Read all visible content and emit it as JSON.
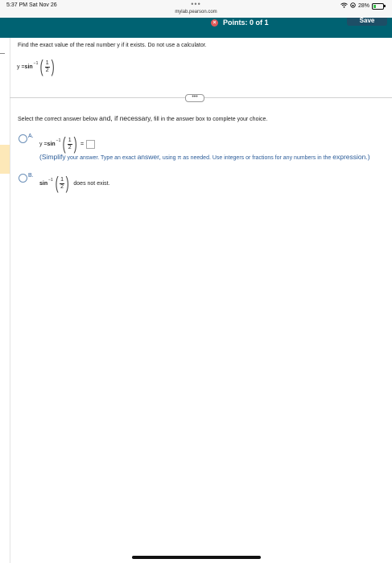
{
  "status_bar": {
    "time": "5:37 PM  Sat Nov 26",
    "dots": "•••",
    "url": "mylab.pearson.com",
    "battery": "28%",
    "battery_level": 0.28
  },
  "header": {
    "points_label": "Points: 0 of 1",
    "save_label": "Save"
  },
  "question": {
    "text": "Find the exact value of the real number y if it exists. Do not use a calculator.",
    "expr_lhs": "y = ",
    "func": "sin",
    "exponent": "−1",
    "frac_num": "1",
    "frac_den": "2"
  },
  "expand_handle": "•••",
  "instruction": {
    "part1": "Select the correct answer below ",
    "part2": "and, if necessary,",
    "part3": " fill in the answer box to complete your choice."
  },
  "options": [
    {
      "letter": "A.",
      "expr_lhs": "y = ",
      "func": "sin",
      "exponent": "−1",
      "frac_num": "1",
      "frac_den": "2",
      "equals": "=",
      "note_part1": "(Simplify",
      "note_part2": " your answer. Type an exact ",
      "note_part3": "answer,",
      "note_part4": " using π as needed. Use integers or fractions for any numbers in the ",
      "note_part5": "expression.)"
    },
    {
      "letter": "B.",
      "func": "sin",
      "exponent": "−1",
      "frac_num": "1",
      "frac_den": "2",
      "tail": "does not exist."
    }
  ]
}
